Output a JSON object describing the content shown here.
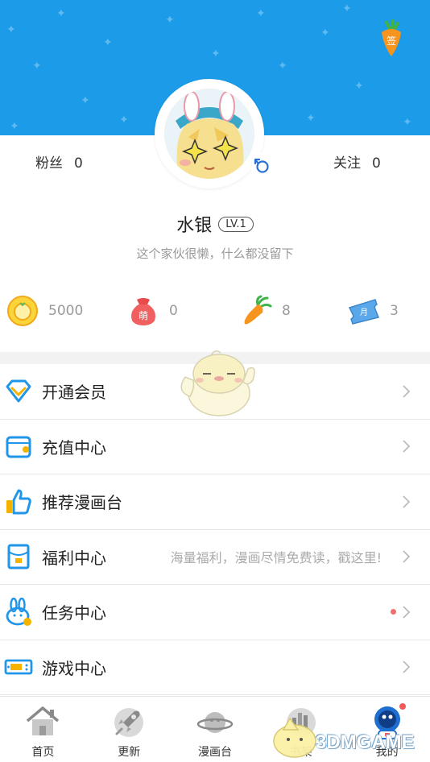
{
  "header": {
    "accent": "#1b9be8",
    "sign_icon_text": "签"
  },
  "profile": {
    "fans_label": "粉丝",
    "fans_count": "0",
    "follow_label": "关注",
    "follow_count": "0",
    "username": "水银",
    "level": "LV.1",
    "bio": "这个家伙很懒，什么都没留下"
  },
  "assets": [
    {
      "icon": "coin-icon",
      "value": "5000"
    },
    {
      "icon": "meng-bag-icon",
      "icon_text": "萌",
      "value": "0"
    },
    {
      "icon": "carrot-icon",
      "value": "8"
    },
    {
      "icon": "ticket-icon",
      "icon_text": "月",
      "value": "3"
    }
  ],
  "menu": [
    {
      "icon": "diamond-icon",
      "label": "开通会员",
      "hint": ""
    },
    {
      "icon": "wallet-icon",
      "label": "充值中心",
      "hint": ""
    },
    {
      "icon": "thumbs-up-icon",
      "label": "推荐漫画台",
      "hint": ""
    },
    {
      "icon": "gift-envelope-icon",
      "label": "福利中心",
      "hint": "海量福利，漫画尽情免费读，戳这里!"
    },
    {
      "icon": "rabbit-icon",
      "label": "任务中心",
      "hint": "",
      "has_dot": true
    },
    {
      "icon": "gamepad-icon",
      "label": "游戏中心",
      "hint": ""
    }
  ],
  "tabs": [
    {
      "icon": "home-icon",
      "label": "首页"
    },
    {
      "icon": "rocket-icon",
      "label": "更新"
    },
    {
      "icon": "planet-icon",
      "label": "漫画台"
    },
    {
      "icon": "bookshelf-icon",
      "label": "书架"
    },
    {
      "icon": "astronaut-icon",
      "label": "我的",
      "active": true,
      "has_dot": true
    }
  ],
  "watermark": "3DMGAME"
}
